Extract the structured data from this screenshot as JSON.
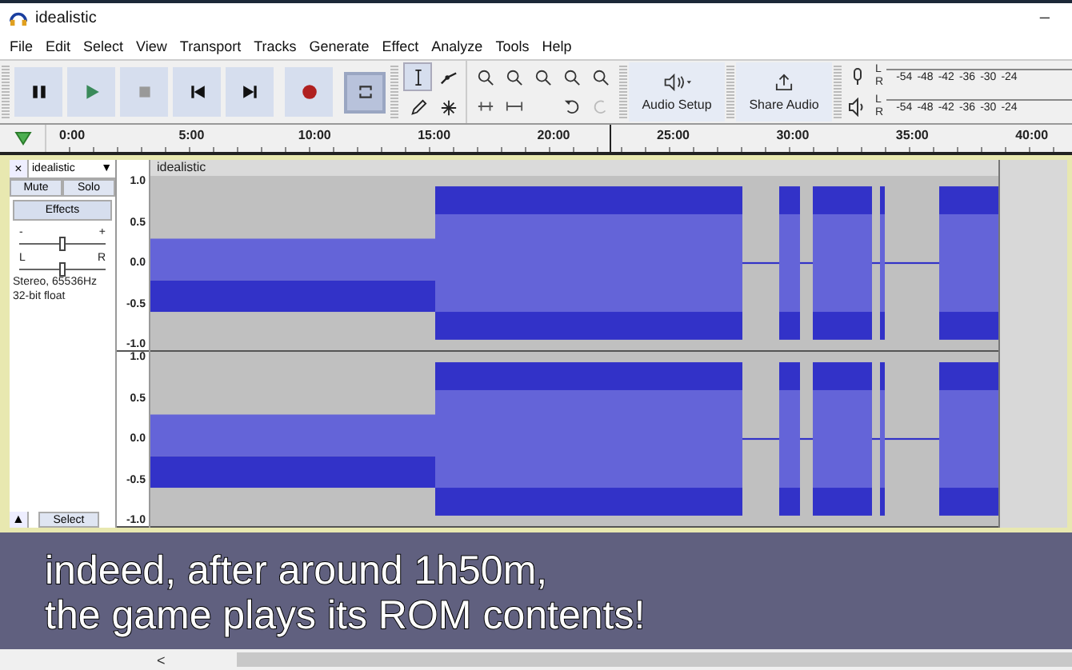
{
  "window": {
    "title": "idealistic",
    "minimize": "–"
  },
  "menu": [
    "File",
    "Edit",
    "Select",
    "View",
    "Transport",
    "Tracks",
    "Generate",
    "Effect",
    "Analyze",
    "Tools",
    "Help"
  ],
  "transport": [
    {
      "kind": "pause",
      "selected": false
    },
    {
      "kind": "play",
      "selected": false
    },
    {
      "kind": "stop",
      "selected": false
    },
    {
      "kind": "skip-start",
      "selected": false
    },
    {
      "kind": "skip-end",
      "selected": false
    },
    {
      "kind": "record",
      "selected": false
    },
    {
      "kind": "loop",
      "selected": true
    }
  ],
  "tools": [
    {
      "kind": "select",
      "selected": true
    },
    {
      "kind": "envelope",
      "selected": false
    },
    {
      "kind": "draw",
      "selected": false
    },
    {
      "kind": "multi",
      "selected": false
    }
  ],
  "audio_setup": "Audio Setup",
  "share_audio": "Share Audio",
  "meters": [
    {
      "kind": "record",
      "channels": [
        "L",
        "R"
      ],
      "scale": [
        "-54",
        "-48",
        "-42",
        "-36",
        "-30",
        "-24"
      ]
    },
    {
      "kind": "playback",
      "channels": [
        "L",
        "R"
      ],
      "scale": [
        "-54",
        "-48",
        "-42",
        "-36",
        "-30",
        "-24"
      ]
    }
  ],
  "ruler": [
    "0:00",
    "5:00",
    "10:00",
    "15:00",
    "20:00",
    "25:00",
    "30:00",
    "35:00",
    "40:00"
  ],
  "track": {
    "close": "×",
    "name": "idealistic",
    "dropdown": "▼",
    "mute": "Mute",
    "solo": "Solo",
    "effects": "Effects",
    "gain": {
      "minus": "-",
      "plus": "+",
      "level": 0.5
    },
    "pan": {
      "left": "L",
      "right": "R",
      "level": 0.5
    },
    "info": [
      "Stereo, 65536Hz",
      "32-bit float"
    ],
    "collapse": "▲",
    "select": "Select",
    "clip_title": "idealistic",
    "channel_scales": [
      [
        "1.0",
        "0.5",
        "0.0",
        "-0.5",
        "-1.0"
      ],
      [
        "1.0",
        "0.5",
        "0.0",
        "-0.5",
        "-1.0"
      ]
    ]
  },
  "subtitle": [
    "indeed, after around 1h50m,",
    "the game plays its ROM contents!"
  ],
  "scrollbar": {
    "arrow": "<"
  }
}
